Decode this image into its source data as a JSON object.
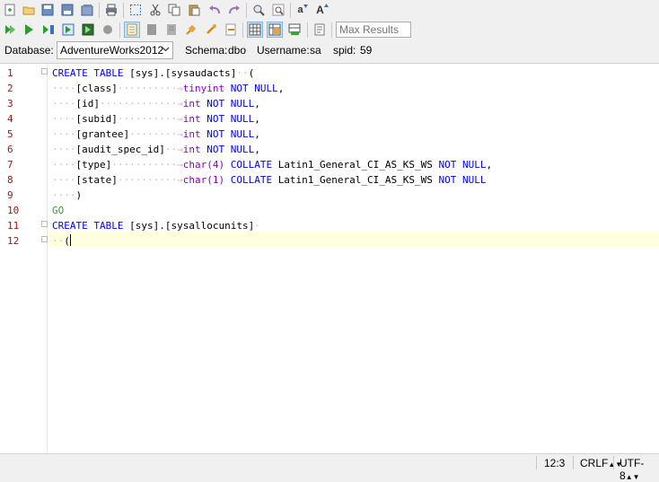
{
  "toolbar": {
    "max_results_placeholder": "Max Results",
    "font_smaller_glyph": "a",
    "font_larger_glyph": "A"
  },
  "info": {
    "database_label": "Database:",
    "database_value": "AdventureWorks2012",
    "schema_label": "Schema:",
    "schema_value": "dbo",
    "username_label": "Username:",
    "username_value": "sa",
    "spid_label": "spid:",
    "spid_value": "59"
  },
  "editor": {
    "line_numbers": [
      "1",
      "2",
      "3",
      "4",
      "5",
      "6",
      "7",
      "8",
      "9",
      "10",
      "11",
      "12"
    ],
    "line1": {
      "kw1": "CREATE",
      "kw2": "TABLE",
      "schema": "[sys]",
      "dot": ".",
      "table": "[sysaudacts]",
      "paren": "("
    },
    "columns": [
      {
        "name": "[class]",
        "type": "tinyint",
        "suffix": "NOT NULL,"
      },
      {
        "name": "[id]",
        "type": "int",
        "suffix": "NOT NULL,"
      },
      {
        "name": "[subid]",
        "type": "int",
        "suffix": "NOT NULL,"
      },
      {
        "name": "[grantee]",
        "type": "int",
        "suffix": "NOT NULL,"
      },
      {
        "name": "[audit_spec_id]",
        "type": "int",
        "suffix": "NOT NULL,"
      },
      {
        "name": "[type]",
        "type": "char(4)",
        "collate": "COLLATE",
        "collation": "Latin1_General_CI_AS_KS_WS",
        "suffix": "NOT NULL,"
      },
      {
        "name": "[state]",
        "type": "char(1)",
        "collate": "COLLATE",
        "collation": "Latin1_General_CI_AS_KS_WS",
        "suffix": "NOT NULL"
      }
    ],
    "close_paren": ")",
    "go": "GO",
    "line11": {
      "kw1": "CREATE",
      "kw2": "TABLE",
      "schema": "[sys]",
      "dot": ".",
      "table": "[sysallocunits]"
    },
    "line12": "("
  },
  "status": {
    "position": "12:3",
    "line_ending": "CRLF",
    "encoding": "UTF-8"
  },
  "colors": {
    "keyword": "#0000ff",
    "type": "#8b00c9",
    "go": "#30a030",
    "line_number": "#a31515",
    "current_line": "#ffffe0"
  }
}
